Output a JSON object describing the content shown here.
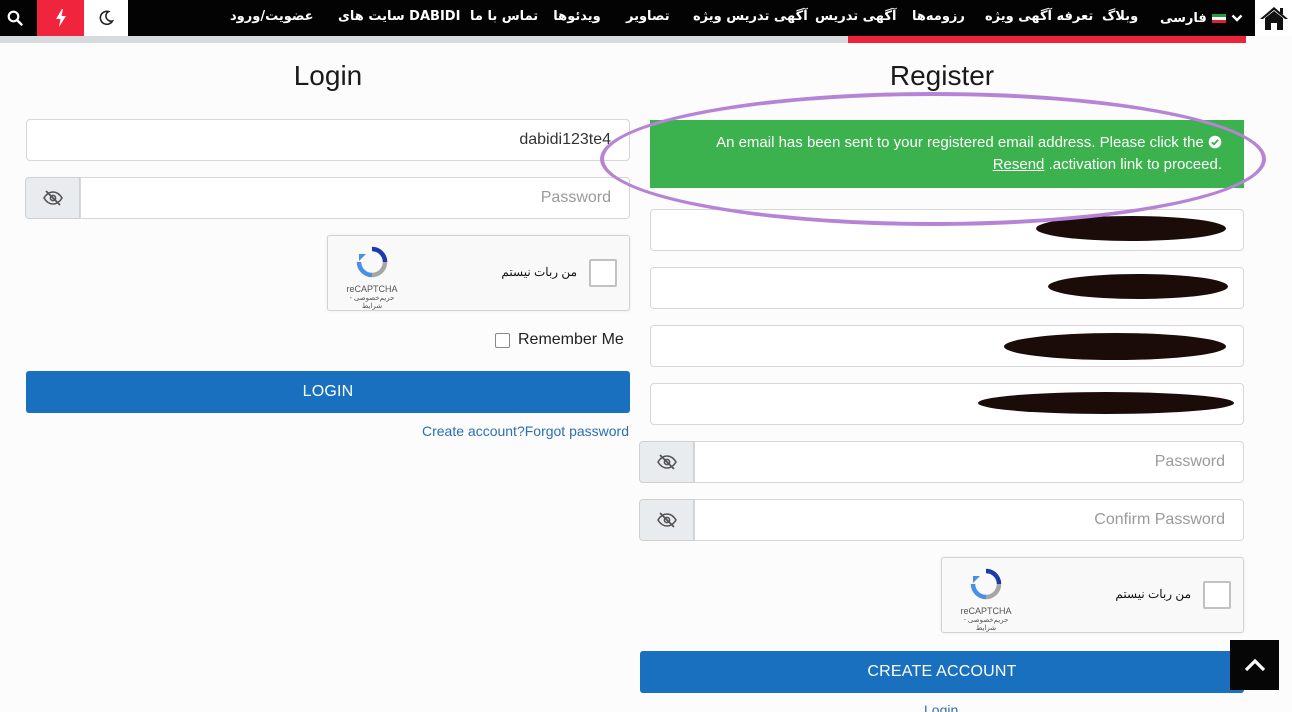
{
  "nav": {
    "items": [
      "عضویت/ورود",
      "سایت های DABIDI",
      "تماس با ما",
      "ویدئوها",
      "تصاویر",
      "آگهی تدریس ویژه",
      "آگهی تدریس",
      "رزومه‌ها",
      "تعرفه آگهی ویژه",
      "وبلاگ"
    ],
    "language": "فارسی",
    "icons": [
      "search-icon",
      "flash-icon",
      "moon-icon",
      "home-icon",
      "chevron-down-icon"
    ]
  },
  "login": {
    "title": "Login",
    "username_value": "dabidi123te4",
    "password_placeholder": "Password",
    "captcha_label": "من ربات نیستم",
    "captcha_brand": "reCAPTCHA",
    "captcha_links": "حریم‌خصوصی - شرایط",
    "remember_label": "Remember Me",
    "login_button": "LOGIN",
    "links_text": "Create account?Forgot password"
  },
  "register": {
    "title": "Register",
    "alert_text": "An email has been sent to your registered email address. Please click the activation link to proceed.",
    "alert_line1": "An email has been sent to your registered email address. Please click the",
    "alert_line2": ".activation link to proceed.",
    "resend_link": "Resend",
    "password_placeholder": "Password",
    "confirm_placeholder": "Confirm Password",
    "captcha_label": "من ربات نیستم",
    "captcha_brand": "reCAPTCHA",
    "captcha_links": "حریم‌خصوصی - شرایط",
    "create_button": "CREATE ACCOUNT",
    "login_link": "Login"
  },
  "colors": {
    "nav_bg": "#030303",
    "accent_red": "#ee2239",
    "alert_green": "#3bb24d",
    "button_blue": "#1870bf",
    "highlight_purple": "#b783d6"
  }
}
